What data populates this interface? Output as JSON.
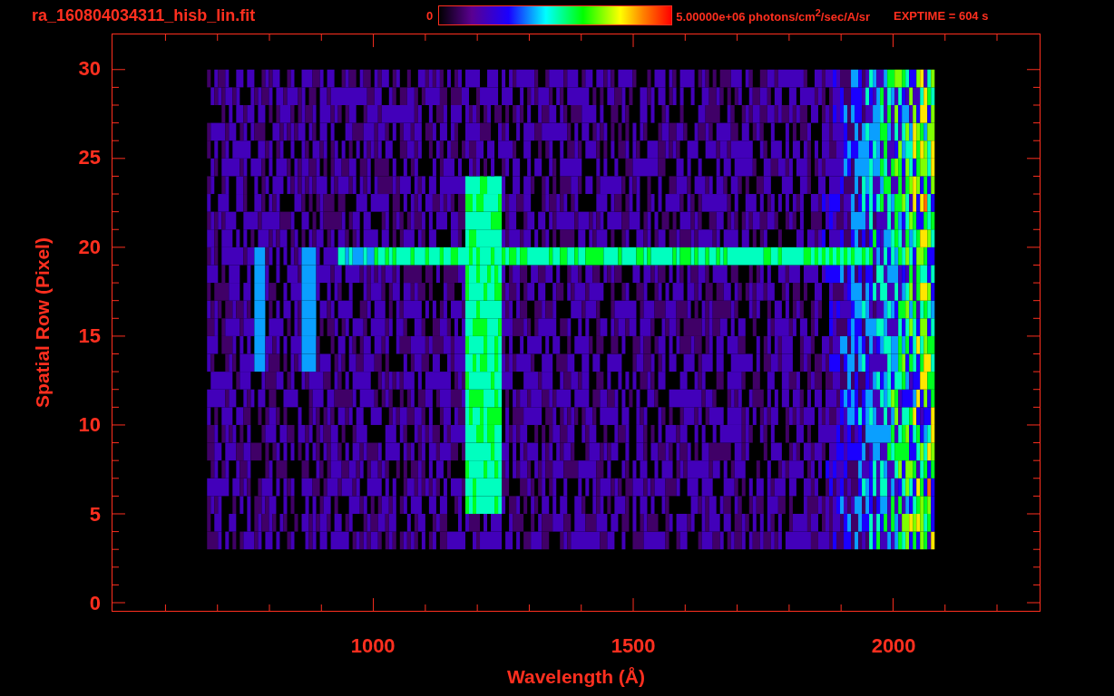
{
  "title": "ra_160804034311_hisb_lin.fit",
  "colorbar": {
    "min_label": "0",
    "max_label": "5.00000e+06 photons/cm$^{2}$/sec/A/sr"
  },
  "exptime": "EXPTIME = 604 s",
  "plot": {
    "y_axis_title": "Spatial Row (Pixel)",
    "y_ticks": [
      "30",
      "25",
      "20",
      "15",
      "10",
      "5",
      "0"
    ],
    "x_axis_title": "Wavelength (Å)",
    "x_ticks": [
      "1000",
      "1500",
      "2000"
    ]
  }
}
